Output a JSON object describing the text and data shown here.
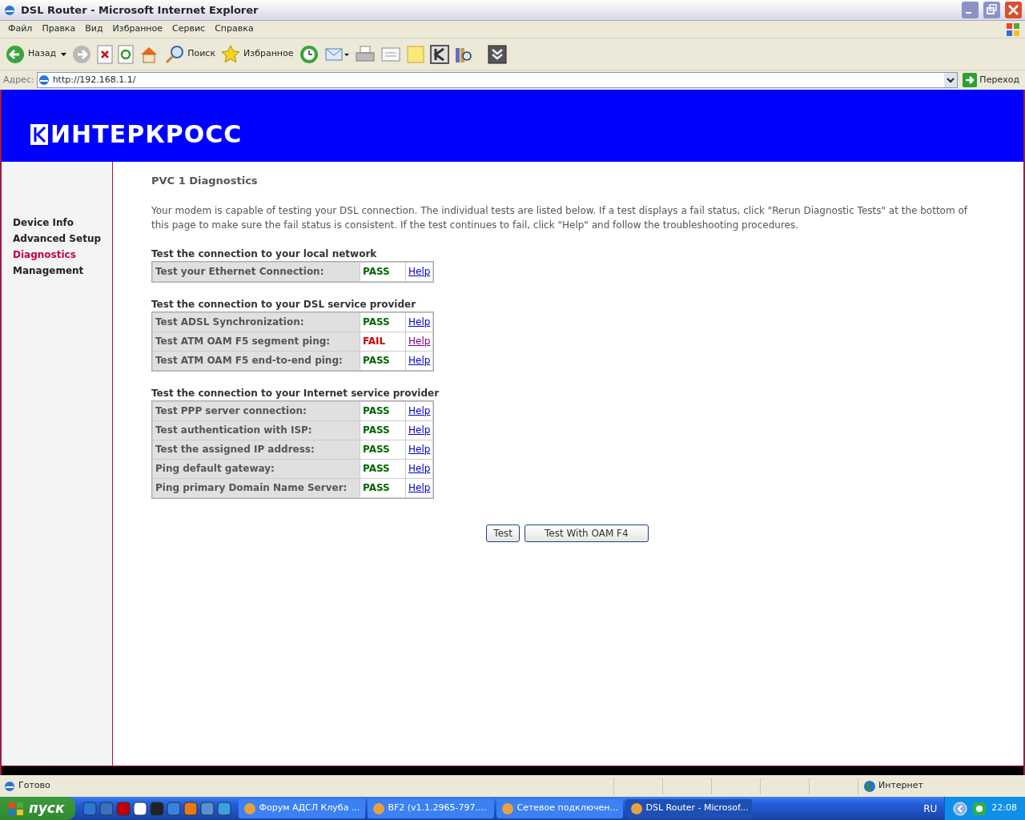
{
  "window": {
    "title": "DSL Router - Microsoft Internet Explorer"
  },
  "menu": [
    "Файл",
    "Правка",
    "Вид",
    "Избранное",
    "Сервис",
    "Справка"
  ],
  "toolbar": {
    "back": "Назад",
    "search": "Поиск",
    "favorites": "Избранное"
  },
  "address": {
    "label": "Адрес:",
    "value": "http://192.168.1.1/",
    "go": "Переход"
  },
  "page": {
    "logo": "ИНТЕРКРОСС",
    "sidebar": [
      {
        "label": "Device Info",
        "selected": false
      },
      {
        "label": "Advanced Setup",
        "selected": false
      },
      {
        "label": "Diagnostics",
        "selected": true
      },
      {
        "label": "Management",
        "selected": false
      }
    ],
    "heading": "PVC 1 Diagnostics",
    "intro": "Your modem is capable of testing your DSL connection. The individual tests are listed below. If a test displays a fail status, click \"Rerun Diagnostic Tests\" at the bottom of this page to make sure the fail status is consistent. If the test continues to fail, click \"Help\" and follow the troubleshooting procedures.",
    "sections": [
      {
        "title": "Test the connection to your local network",
        "rows": [
          {
            "test": "Test your Ethernet Connection:",
            "result": "PASS",
            "passed": true,
            "help": "Help",
            "visited": false
          }
        ]
      },
      {
        "title": "Test the connection to your DSL service provider",
        "rows": [
          {
            "test": "Test ADSL Synchronization:",
            "result": "PASS",
            "passed": true,
            "help": "Help",
            "visited": false
          },
          {
            "test": "Test ATM OAM F5 segment ping:",
            "result": "FAIL",
            "passed": false,
            "help": "Help",
            "visited": true
          },
          {
            "test": "Test ATM OAM F5 end-to-end ping:",
            "result": "PASS",
            "passed": true,
            "help": "Help",
            "visited": false
          }
        ]
      },
      {
        "title": "Test the connection to your Internet service provider",
        "rows": [
          {
            "test": "Test PPP server connection:",
            "result": "PASS",
            "passed": true,
            "help": "Help",
            "visited": false
          },
          {
            "test": "Test authentication with ISP:",
            "result": "PASS",
            "passed": true,
            "help": "Help",
            "visited": false
          },
          {
            "test": "Test the assigned IP address:",
            "result": "PASS",
            "passed": true,
            "help": "Help",
            "visited": false
          },
          {
            "test": "Ping default gateway:",
            "result": "PASS",
            "passed": true,
            "help": "Help",
            "visited": false
          },
          {
            "test": "Ping primary Domain Name Server:",
            "result": "PASS",
            "passed": true,
            "help": "Help",
            "visited": false
          }
        ]
      }
    ],
    "buttons": [
      "Test",
      "Test With OAM F4"
    ]
  },
  "status_bar": {
    "text": "Готово",
    "zone": "Интернет"
  },
  "taskbar": {
    "start": "пуск",
    "tasks": [
      {
        "label": "Форум АДСЛ Клуба ...",
        "selected": false
      },
      {
        "label": "BF2 (v1.1.2965-797....",
        "selected": false
      },
      {
        "label": "Сетевое подключен...",
        "selected": false
      },
      {
        "label": "DSL Router - Microsof...",
        "selected": true
      }
    ],
    "language": "RU",
    "clock": "22:08"
  }
}
